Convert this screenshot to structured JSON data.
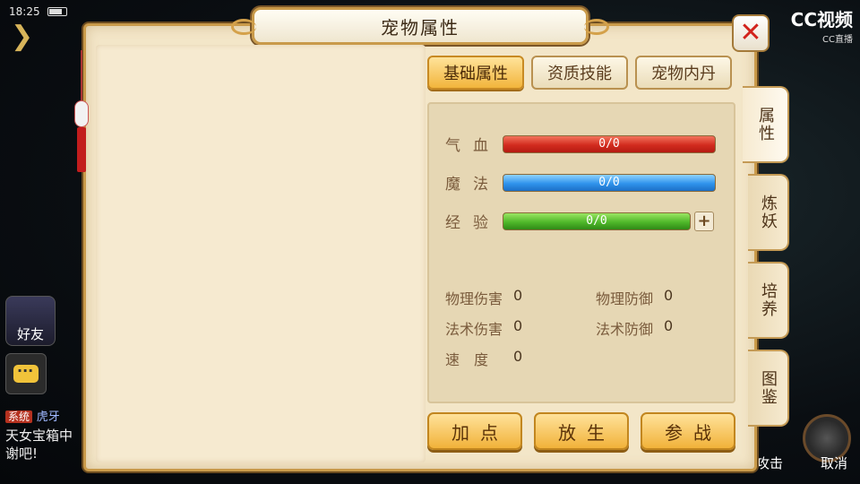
{
  "status_bar": {
    "time": "18:25"
  },
  "dialog": {
    "title": "宠物属性",
    "tabs": [
      {
        "label": "基础属性",
        "active": true
      },
      {
        "label": "资质技能",
        "active": false
      },
      {
        "label": "宠物内丹",
        "active": false
      }
    ],
    "bars": {
      "hp": {
        "label": "气血",
        "value": "0/0"
      },
      "mp": {
        "label": "魔法",
        "value": "0/0"
      },
      "exp": {
        "label": "经验",
        "value": "0/0"
      }
    },
    "stats": {
      "phys_attack": {
        "label": "物理伤害",
        "value": "0"
      },
      "phys_defense": {
        "label": "物理防御",
        "value": "0"
      },
      "magic_attack": {
        "label": "法术伤害",
        "value": "0"
      },
      "magic_defense": {
        "label": "法术防御",
        "value": "0"
      },
      "speed": {
        "label": "速　度",
        "value": "0"
      }
    },
    "buttons": {
      "add_points": "加点",
      "release": "放生",
      "battle": "参战"
    },
    "side_tabs": [
      {
        "label": "属性",
        "active": true
      },
      {
        "label": "炼妖",
        "active": false
      },
      {
        "label": "培养",
        "active": false
      },
      {
        "label": "图鉴",
        "active": false
      }
    ]
  },
  "hud": {
    "friends_label": "好友",
    "chat_tag": "系统",
    "chat_sender": "虎牙",
    "chat_line1": "天女宝箱中",
    "chat_line2": "谢吧!",
    "cancel_label": "取消",
    "attack_label": "攻击",
    "stream_logo": "CC视频",
    "stream_logo_sub": "CC直播"
  },
  "colors": {
    "accent_gold": "#f1b23a",
    "hp_red": "#d22b1e",
    "mp_blue": "#2f93ec",
    "exp_green": "#4fb82a",
    "close_red": "#d2231c"
  }
}
